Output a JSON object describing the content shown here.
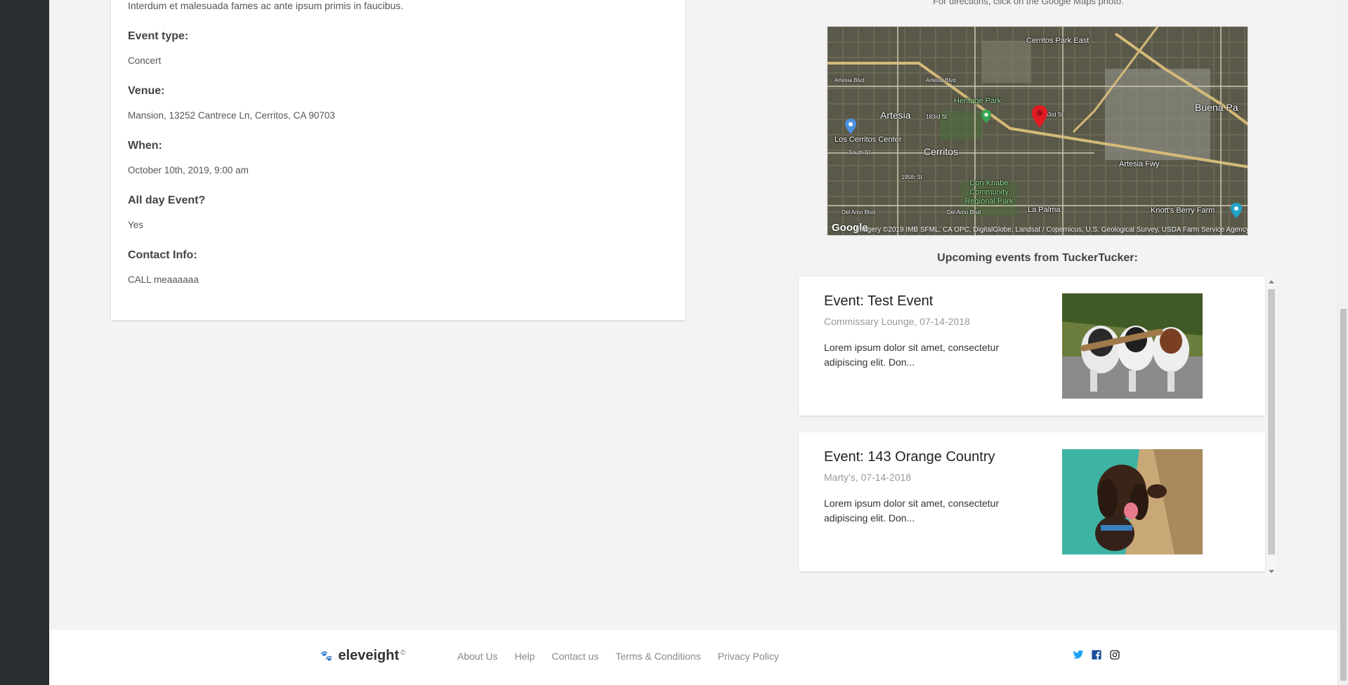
{
  "details": {
    "intro": "Interdum et malesuada fames ac ante ipsum primis in faucibus.",
    "fields": [
      {
        "label": "Event type:",
        "value": "Concert"
      },
      {
        "label": "Venue:",
        "value": "Mansion, 13252 Cantrece Ln, Cerritos, CA 90703"
      },
      {
        "label": "When:",
        "value": "October 10th, 2019, 9:00 am"
      },
      {
        "label": "All day Event?",
        "value": "Yes"
      },
      {
        "label": "Contact Info:",
        "value": "CALL meaaaaaa"
      }
    ]
  },
  "map": {
    "hint": "For directions, click on the Google Maps photo.",
    "logo": "Google",
    "attribution": "Imagery ©2019 IMB SFML, CA OPC, DigitalGlobe, Landsat / Copernicus, U.S. Geological Survey, USDA Farm Service Agency",
    "labels": {
      "cerritos_park_east": "Cerritos Park East",
      "heritage_park": "Heritage Park",
      "artesia": "Artesia",
      "los_cerritos_center": "Los Cerritos Center",
      "cerritos": "Cerritos",
      "buena_park": "Buena Pa",
      "artesia_fwy": "Artesia Fwy",
      "don_knabe": "Don Knabe Community Regional Park",
      "la_palma": "La Palma",
      "knotts": "Knott's Berry Farm",
      "artesia_blvd": "Artesia Blvd",
      "artesia_blvd2": "Artesia Blvd",
      "st_183rd": "183rd St",
      "st_183rd_b": "183rd St",
      "south_st": "South St",
      "st_195th": "195th St",
      "del_amo": "Del Amo Blvd",
      "del_amo2": "Del Amo Blvd"
    }
  },
  "upcoming": {
    "heading": "Upcoming events from TuckerTucker:",
    "events": [
      {
        "title": "Event: Test Event",
        "meta": "Commissary Lounge, 07-14-2018",
        "desc": "Lorem ipsum dolor sit amet, consectetur adipiscing elit. Don..."
      },
      {
        "title": "Event: 143 Orange Country",
        "meta": "Marty's, 07-14-2018",
        "desc": "Lorem ipsum dolor sit amet, consectetur adipiscing elit. Don..."
      }
    ]
  },
  "footer": {
    "brand": "eleveight",
    "copyright": "©",
    "links": [
      "About Us",
      "Help",
      "Contact us",
      "Terms & Conditions",
      "Privacy Policy"
    ],
    "socials": [
      "twitter-icon",
      "facebook-icon",
      "instagram-icon"
    ]
  },
  "colors": {
    "twitter": "#1da1f2",
    "facebook": "#1b4f9c",
    "marker": "#e01b24"
  }
}
